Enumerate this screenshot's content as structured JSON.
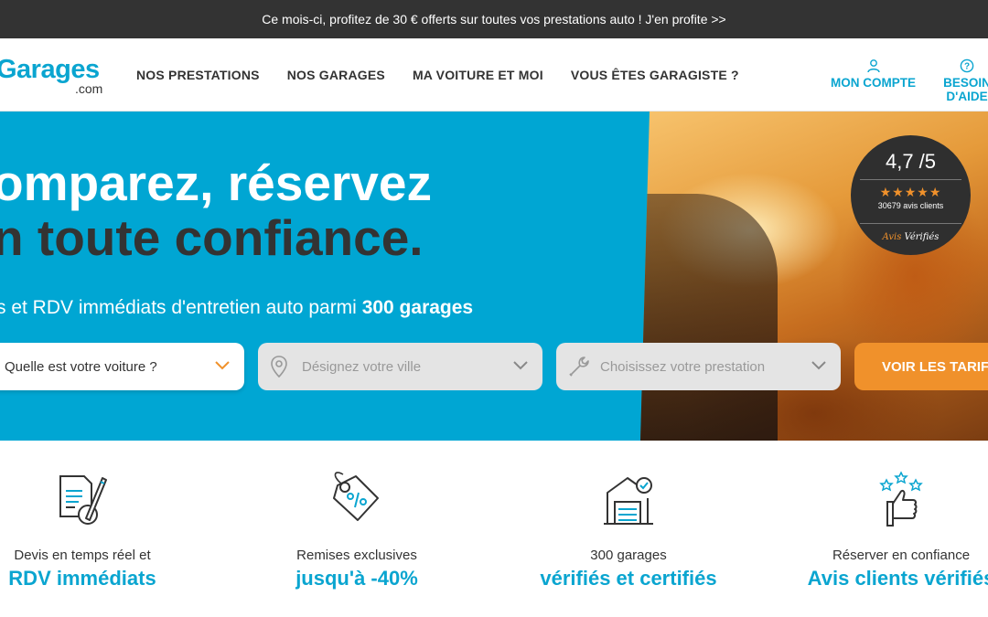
{
  "promo": {
    "text": "Ce mois-ci, profitez de 30 € offerts sur toutes vos prestations auto ! J'en profite >>"
  },
  "header": {
    "logo_word": "Garages",
    "logo_suffix": ".com",
    "nav": [
      "NOS PRESTATIONS",
      "NOS GARAGES",
      "MA VOITURE ET MOI",
      "VOUS ÊTES GARAGISTE ?"
    ],
    "account_label": "MON COMPTE",
    "help_label": "BESOIN D'AIDE"
  },
  "hero": {
    "title_line1": "omparez, réservez",
    "title_line2": "n toute confiance.",
    "subtitle_prefix": "s et RDV immédiats d'entretien auto parmi ",
    "subtitle_bold": "300 garages",
    "car_select": "Quelle est votre voiture ?",
    "city_placeholder": "Désignez votre ville",
    "service_placeholder": "Choisissez votre prestation",
    "cta": "VOIR LES TARIFS"
  },
  "rating": {
    "score": "4,7 /5",
    "stars": "★★★★★",
    "count": "30679 avis clients",
    "brand_accent": "Avis",
    "brand": " Vérifiés"
  },
  "features": [
    {
      "icon": "quote-document-icon",
      "caption": "Devis en temps réel et",
      "highlight": "RDV immédiats"
    },
    {
      "icon": "discount-tag-icon",
      "caption": "Remises exclusives",
      "highlight": "jusqu'à -40%"
    },
    {
      "icon": "certified-garage-icon",
      "caption": "300 garages",
      "highlight": "vérifiés et certifiés"
    },
    {
      "icon": "thumbs-up-stars-icon",
      "caption": "Réserver en confiance",
      "highlight": "Avis clients vérifiés"
    }
  ],
  "colors": {
    "brand_blue": "#00a6d3",
    "accent_orange": "#f0912b",
    "dark": "#333333"
  }
}
